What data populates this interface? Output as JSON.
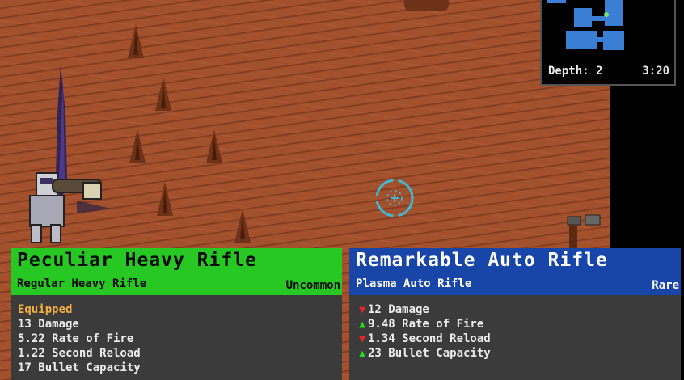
{
  "minimap": {
    "depth_label": "Depth:",
    "depth_value": "2",
    "time": "3:20"
  },
  "card_left": {
    "title": "Peculiar Heavy Rifle",
    "subtitle": "Regular Heavy Rifle",
    "rarity": "Uncommon",
    "status": "Equipped",
    "stats": [
      "13 Damage",
      "5.22 Rate of Fire",
      "1.22 Second Reload",
      "17 Bullet Capacity"
    ],
    "color": "#27c823"
  },
  "card_right": {
    "title": "Remarkable Auto Rifle",
    "subtitle": "Plasma Auto Rifle",
    "rarity": "Rare",
    "stats": [
      {
        "dir": "down",
        "text": "12 Damage"
      },
      {
        "dir": "up",
        "text": "9.48 Rate of Fire"
      },
      {
        "dir": "down",
        "text": "1.34 Second Reload"
      },
      {
        "dir": "up",
        "text": "23 Bullet Capacity"
      }
    ],
    "color": "#1846a8"
  },
  "colors": {
    "ground": "#a3502d",
    "spike": "#6e3218",
    "minimap_room": "#3a7fd5",
    "crosshair": "#3fb9d6"
  },
  "icons": [
    "crosshair-icon",
    "arrow-up-icon",
    "arrow-down-icon",
    "minimap-player-marker-icon"
  ]
}
